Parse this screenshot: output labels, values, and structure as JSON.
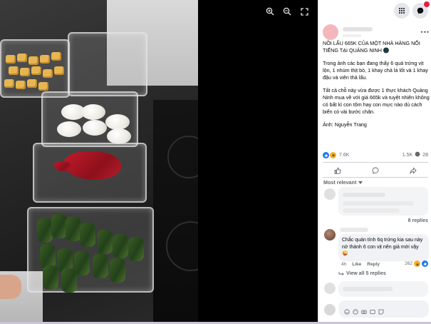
{
  "viewer": {
    "tools": [
      {
        "name": "zoom-in-icon"
      },
      {
        "name": "zoom-out-icon"
      },
      {
        "name": "fullscreen-icon"
      }
    ]
  },
  "post": {
    "title": "NỒI LẨU 665K CỦA MỘT NHÀ HÀNG NỔI TIẾNG TẠI QUẢNG NINH 🌑",
    "paragraph1": "Trong ảnh các bạn đang thấy 6 quả trứng vịt lộn, 1 nhúm thịt bò, 1 khay chả lá lốt và 1 khay đậu và viên thả lẩu.",
    "paragraph2": "Tất cả chỗ này vừa được 1 thực khách Quảng Ninh mua về với giá 665k và tuyệt nhiên không có bất kì con tôm hay con mực nào dù cách biển có vài bước chân.",
    "credit": "Ảnh: Nguyễn Trang"
  },
  "stats": {
    "reactions_count": "7.6K",
    "comments_count": "1.5K",
    "shares_count": "28"
  },
  "comments": {
    "sort_label": "Most relevant",
    "replies_label": "8 replies",
    "featured": {
      "text": "Chắc quán tính 6q trứng kia sau này nở thành 6 con vịt nên giá mới vậy 😜",
      "time": "4h",
      "like": "Like",
      "reply": "Reply",
      "reactions": "262"
    },
    "view_all": "View all 5 replies"
  },
  "colors": {
    "accent": "#1877f2",
    "haha": "#f7b125",
    "panel_bg": "#ffffff",
    "viewer_bg": "#000000"
  }
}
